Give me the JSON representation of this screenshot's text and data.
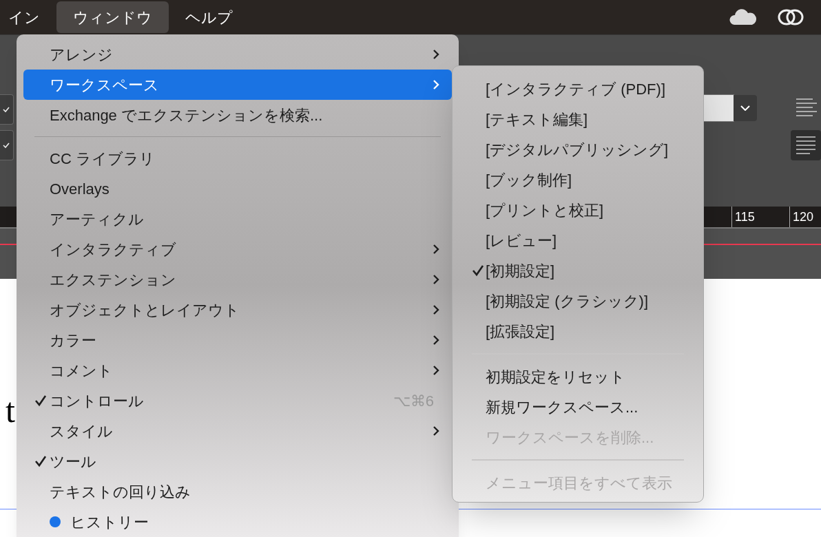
{
  "menu_bar": {
    "items": [
      {
        "label": "イン",
        "selected": false
      },
      {
        "label": "ウィンドウ",
        "selected": true
      },
      {
        "label": "ヘルプ",
        "selected": false
      }
    ]
  },
  "toolbar": {
    "checkboxes": [
      {
        "checked": true
      },
      {
        "checked": true
      }
    ]
  },
  "ruler": {
    "labels": [
      "115",
      "120"
    ]
  },
  "document": {
    "text": "t"
  },
  "window_menu": {
    "items": [
      {
        "kind": "item",
        "label": "アレンジ",
        "submenu": true,
        "selected": false,
        "checked": false
      },
      {
        "kind": "item",
        "label": "ワークスペース",
        "submenu": true,
        "selected": true,
        "checked": false
      },
      {
        "kind": "item",
        "label": "Exchange でエクステンションを検索...",
        "submenu": false,
        "selected": false,
        "checked": false
      },
      {
        "kind": "separator"
      },
      {
        "kind": "item",
        "label": "CC ライブラリ",
        "submenu": false,
        "selected": false,
        "checked": false
      },
      {
        "kind": "item",
        "label": "Overlays",
        "submenu": false,
        "selected": false,
        "checked": false
      },
      {
        "kind": "item",
        "label": "アーティクル",
        "submenu": false,
        "selected": false,
        "checked": false
      },
      {
        "kind": "item",
        "label": "インタラクティブ",
        "submenu": true,
        "selected": false,
        "checked": false
      },
      {
        "kind": "item",
        "label": "エクステンション",
        "submenu": true,
        "selected": false,
        "checked": false
      },
      {
        "kind": "item",
        "label": "オブジェクトとレイアウト",
        "submenu": true,
        "selected": false,
        "checked": false
      },
      {
        "kind": "item",
        "label": "カラー",
        "submenu": true,
        "selected": false,
        "checked": false
      },
      {
        "kind": "item",
        "label": "コメント",
        "submenu": true,
        "selected": false,
        "checked": false
      },
      {
        "kind": "item",
        "label": "コントロール",
        "submenu": false,
        "selected": false,
        "checked": true,
        "shortcut": "⌥⌘6"
      },
      {
        "kind": "item",
        "label": "スタイル",
        "submenu": true,
        "selected": false,
        "checked": false
      },
      {
        "kind": "item",
        "label": "ツール",
        "submenu": false,
        "selected": false,
        "checked": true
      },
      {
        "kind": "item",
        "label": "テキストの回り込み",
        "submenu": false,
        "selected": false,
        "checked": false
      },
      {
        "kind": "item",
        "label": "ヒストリー",
        "submenu": false,
        "selected": false,
        "checked": false,
        "color": "#1a73e8"
      }
    ]
  },
  "workspace_submenu": {
    "items": [
      {
        "kind": "item",
        "label": "[インタラクティブ (PDF)]",
        "checked": false,
        "disabled": false
      },
      {
        "kind": "item",
        "label": "[テキスト編集]",
        "checked": false,
        "disabled": false
      },
      {
        "kind": "item",
        "label": "[デジタルパブリッシング]",
        "checked": false,
        "disabled": false
      },
      {
        "kind": "item",
        "label": "[ブック制作]",
        "checked": false,
        "disabled": false
      },
      {
        "kind": "item",
        "label": "[プリントと校正]",
        "checked": false,
        "disabled": false
      },
      {
        "kind": "item",
        "label": "[レビュー]",
        "checked": false,
        "disabled": false
      },
      {
        "kind": "item",
        "label": "[初期設定]",
        "checked": true,
        "disabled": false
      },
      {
        "kind": "item",
        "label": "[初期設定 (クラシック)]",
        "checked": false,
        "disabled": false
      },
      {
        "kind": "item",
        "label": "[拡張設定]",
        "checked": false,
        "disabled": false
      },
      {
        "kind": "separator"
      },
      {
        "kind": "item",
        "label": "初期設定をリセット",
        "checked": false,
        "disabled": false
      },
      {
        "kind": "item",
        "label": "新規ワークスペース...",
        "checked": false,
        "disabled": false
      },
      {
        "kind": "item",
        "label": "ワークスペースを削除...",
        "checked": false,
        "disabled": true
      },
      {
        "kind": "separator"
      },
      {
        "kind": "item",
        "label": "メニュー項目をすべて表示",
        "checked": false,
        "disabled": true
      }
    ]
  }
}
